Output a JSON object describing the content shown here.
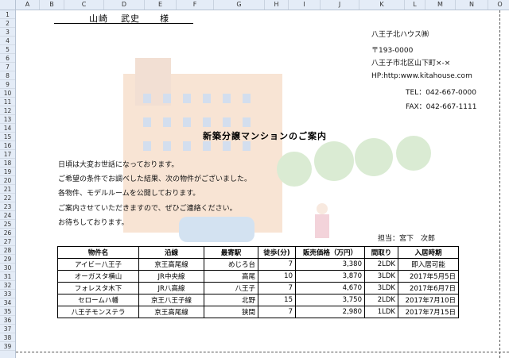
{
  "columns": [
    "A",
    "B",
    "C",
    "D",
    "E",
    "F",
    "G",
    "H",
    "I",
    "J",
    "K",
    "L",
    "M",
    "N",
    "O"
  ],
  "rows": [
    "1",
    "2",
    "3",
    "4",
    "5",
    "6",
    "7",
    "8",
    "9",
    "10",
    "11",
    "12",
    "13",
    "14",
    "15",
    "16",
    "17",
    "18",
    "19",
    "20",
    "21",
    "22",
    "23",
    "24",
    "25",
    "26",
    "27",
    "28",
    "29",
    "30",
    "31",
    "32",
    "33",
    "34",
    "35",
    "36",
    "37",
    "38",
    "39"
  ],
  "recipient": {
    "surname": "山崎",
    "given": "武史",
    "honorific": "様"
  },
  "company": {
    "name": "八王子北ハウス㈱",
    "postal": "〒193-0000",
    "address": "八王子市北区山下町×-×",
    "hp": "HP:http:www.kitahouse.com",
    "tel": "TEL：042-667-0000",
    "fax": "FAX：042-667-1111"
  },
  "title": "新築分譲マンションのご案内",
  "body": [
    "日頃は大変お世話になっております。",
    "ご希望の条件でお調べした結果、次の物件がございました。",
    "各物件、モデルルームを公開しております。",
    "ご案内させていただきますので、ぜひご連絡ください。",
    "お待ちしております。"
  ],
  "staff": {
    "label": "担当：",
    "name": "宮下　次郎"
  },
  "table": {
    "headers": [
      "物件名",
      "沿線",
      "最寄駅",
      "徒歩(分)",
      "販売価格（万円）",
      "間取り",
      "入居時期"
    ],
    "rows": [
      [
        "アイビー八王子",
        "京王高尾線",
        "めじろ台",
        "7",
        "3,380",
        "2LDK",
        "即入居可能"
      ],
      [
        "オーガスタ横山",
        "JR中央線",
        "高尾",
        "10",
        "3,870",
        "3LDK",
        "2017年5月5日"
      ],
      [
        "フォレスタ木下",
        "JR八高線",
        "八王子",
        "7",
        "4,670",
        "3LDK",
        "2017年6月7日"
      ],
      [
        "セロームハ幡",
        "京王八王子線",
        "北野",
        "15",
        "3,750",
        "2LDK",
        "2017年7月10日"
      ],
      [
        "八王子モンステラ",
        "京王高尾線",
        "狭間",
        "7",
        "2,980",
        "1LDK",
        "2017年7月15日"
      ]
    ]
  }
}
